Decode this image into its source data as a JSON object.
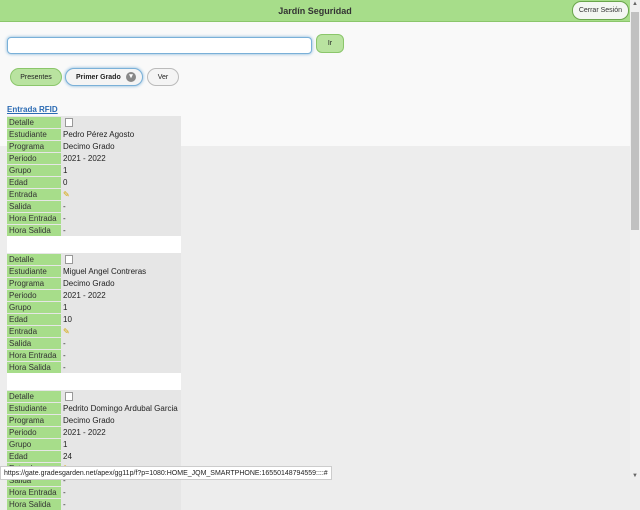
{
  "header": {
    "title": "Jardín Seguridad",
    "logout_label": "Cerrar Sesión"
  },
  "search": {
    "value": "",
    "go_label": "Ir"
  },
  "filters": {
    "presentes_label": "Presentes",
    "grado_value": "Primer Grado",
    "ver_label": "Ver"
  },
  "section_title": "Entrada RFID",
  "labels": {
    "detalle": "Detalle",
    "estudiante": "Estudiante",
    "programa": "Programa",
    "periodo": "Periodo",
    "grupo": "Grupo",
    "edad": "Edad",
    "entrada": "Entrada",
    "salida": "Salida",
    "hora_entrada": "Hora Entrada",
    "hora_salida": "Hora Salida"
  },
  "records": [
    {
      "estudiante": "Pedro Pérez Agosto",
      "programa": "Decimo Grado",
      "periodo": "2021 - 2022",
      "grupo": "1",
      "edad": "0",
      "salida": "-",
      "hora_entrada": "-",
      "hora_salida": "-"
    },
    {
      "estudiante": "Miguel Angel Contreras",
      "programa": "Decimo Grado",
      "periodo": "2021 - 2022",
      "grupo": "1",
      "edad": "10",
      "salida": "-",
      "hora_entrada": "-",
      "hora_salida": "-"
    },
    {
      "estudiante": "Pedrito Domingo Ardubal Garcia",
      "programa": "Decimo Grado",
      "periodo": "2021 - 2022",
      "grupo": "1",
      "edad": "24",
      "salida": "-",
      "hora_entrada": "-",
      "hora_salida": "-"
    }
  ],
  "status_url": "https://gate.gradesgarden.net/apex/gg11p/f?p=1080:HOME_JQM_SMARTPHONE:16550148794559::::#"
}
